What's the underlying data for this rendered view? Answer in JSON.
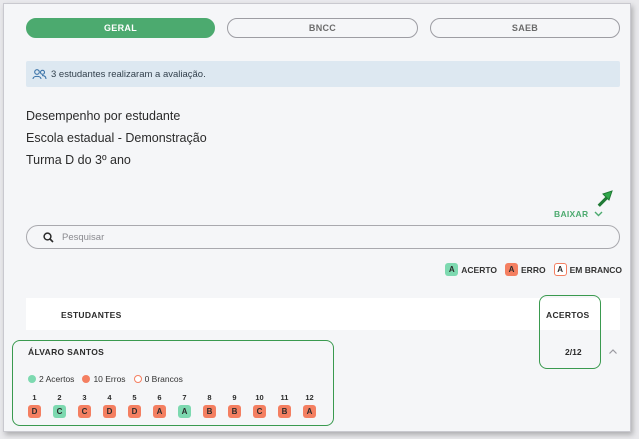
{
  "tabs": [
    {
      "label": "GERAL",
      "active": true
    },
    {
      "label": "BNCC",
      "active": false
    },
    {
      "label": "SAEB",
      "active": false
    }
  ],
  "info_banner": {
    "icon": "users-icon",
    "text": "3 estudantes realizaram a avaliação."
  },
  "headings": {
    "title": "Desempenho por estudante",
    "school": "Escola estadual - Demonstração",
    "class": "Turma D do 3º ano"
  },
  "download": {
    "label": "BAIXAR"
  },
  "search": {
    "placeholder": "Pesquisar",
    "value": ""
  },
  "legend": [
    {
      "letter": "A",
      "label": "ACERTO",
      "kind": "correct"
    },
    {
      "letter": "A",
      "label": "ERRO",
      "kind": "wrong"
    },
    {
      "letter": "A",
      "label": "EM BRANCO",
      "kind": "blank"
    }
  ],
  "table": {
    "col_students": "ESTUDANTES",
    "col_hits": "ACERTOS"
  },
  "student": {
    "name": "ÁLVARO SANTOS",
    "score": "2/12",
    "summary": {
      "correct": "2 Acertos",
      "wrong": "10 Erros",
      "blank": "0 Brancos"
    },
    "answers": [
      {
        "num": "1",
        "letter": "D",
        "kind": "wrong"
      },
      {
        "num": "2",
        "letter": "C",
        "kind": "correct"
      },
      {
        "num": "3",
        "letter": "C",
        "kind": "wrong"
      },
      {
        "num": "4",
        "letter": "D",
        "kind": "wrong"
      },
      {
        "num": "5",
        "letter": "D",
        "kind": "wrong"
      },
      {
        "num": "6",
        "letter": "A",
        "kind": "wrong"
      },
      {
        "num": "7",
        "letter": "A",
        "kind": "correct"
      },
      {
        "num": "8",
        "letter": "B",
        "kind": "wrong"
      },
      {
        "num": "9",
        "letter": "B",
        "kind": "wrong"
      },
      {
        "num": "10",
        "letter": "C",
        "kind": "wrong"
      },
      {
        "num": "11",
        "letter": "B",
        "kind": "wrong"
      },
      {
        "num": "12",
        "letter": "A",
        "kind": "wrong"
      }
    ]
  },
  "colors": {
    "accent": "#4caa6f",
    "correct": "#7dd9b0",
    "wrong": "#f47f61",
    "banner": "#dde8f1"
  }
}
